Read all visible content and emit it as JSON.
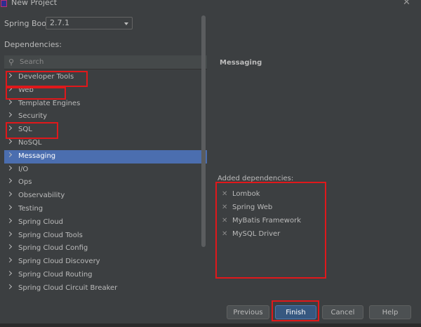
{
  "window": {
    "title": "New Project"
  },
  "spring_boot": {
    "label": "Spring Boot:",
    "value": "2.7.1"
  },
  "dependencies": {
    "label": "Dependencies:",
    "search_placeholder": "Search",
    "items": [
      {
        "label": "Developer Tools"
      },
      {
        "label": "Web"
      },
      {
        "label": "Template Engines"
      },
      {
        "label": "Security"
      },
      {
        "label": "SQL"
      },
      {
        "label": "NoSQL"
      },
      {
        "label": "Messaging"
      },
      {
        "label": "I/O"
      },
      {
        "label": "Ops"
      },
      {
        "label": "Observability"
      },
      {
        "label": "Testing"
      },
      {
        "label": "Spring Cloud"
      },
      {
        "label": "Spring Cloud Tools"
      },
      {
        "label": "Spring Cloud Config"
      },
      {
        "label": "Spring Cloud Discovery"
      },
      {
        "label": "Spring Cloud Routing"
      },
      {
        "label": "Spring Cloud Circuit Breaker"
      }
    ],
    "selected": "Messaging"
  },
  "detail": {
    "title": "Messaging"
  },
  "added_dependencies": {
    "label": "Added dependencies:",
    "items": [
      {
        "label": "Lombok"
      },
      {
        "label": "Spring Web"
      },
      {
        "label": "MyBatis Framework"
      },
      {
        "label": "MySQL Driver"
      }
    ]
  },
  "buttons": {
    "previous": "Previous",
    "finish": "Finish",
    "cancel": "Cancel",
    "help": "Help"
  },
  "annotation_color": "#e0181b",
  "accent_color": "#4b6eaf"
}
